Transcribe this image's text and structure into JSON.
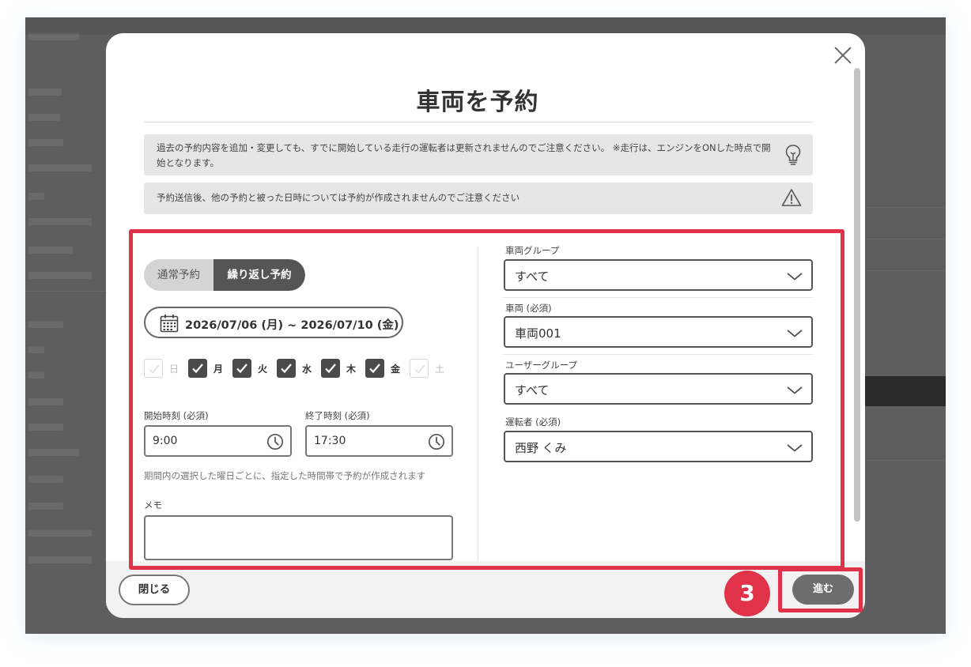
{
  "modal": {
    "title": "車両を予約",
    "notices": [
      {
        "text": "過去の予約内容を追加・変更しても、すでに開始している走行の運転者は更新されませんのでご注意ください。 ※走行は、エンジンをONした時点で開始となります。",
        "icon": "lightbulb-icon"
      },
      {
        "text": "予約送信後、他の予約と被った日時については予約が作成されませんのでご注意ください",
        "icon": "warning-icon"
      }
    ]
  },
  "reservation_type": {
    "options": [
      "通常予約",
      "繰り返し予約"
    ],
    "selected": "繰り返し予約"
  },
  "date_range": {
    "text": "2026/07/06 (月) ~ 2026/07/10 (金)",
    "icon": "calendar-icon"
  },
  "weekdays": [
    {
      "label": "日",
      "checked": false
    },
    {
      "label": "月",
      "checked": true
    },
    {
      "label": "火",
      "checked": true
    },
    {
      "label": "水",
      "checked": true
    },
    {
      "label": "木",
      "checked": true
    },
    {
      "label": "金",
      "checked": true
    },
    {
      "label": "土",
      "checked": false
    }
  ],
  "start_time": {
    "label": "開始時刻 (必須)",
    "value": "9:00"
  },
  "end_time": {
    "label": "終了時刻 (必須)",
    "value": "17:30"
  },
  "hint": "期間内の選択した曜日ごとに、指定した時間帯で予約が作成されます",
  "memo": {
    "label": "メモ",
    "value": ""
  },
  "vehicle_group": {
    "label": "車両グループ",
    "value": "すべて"
  },
  "vehicle": {
    "label": "車両 (必須)",
    "value": "車両001"
  },
  "user_group": {
    "label": "ユーザーグループ",
    "value": "すべて"
  },
  "driver": {
    "label": "運転者 (必須)",
    "value": "西野 くみ"
  },
  "footer": {
    "close_label": "閉じる",
    "next_label": "進む"
  },
  "step_badge": "3",
  "colors": {
    "highlight": "#e0334a",
    "dark": "#4a4a4a",
    "accent_button": "#6d6d6d"
  }
}
